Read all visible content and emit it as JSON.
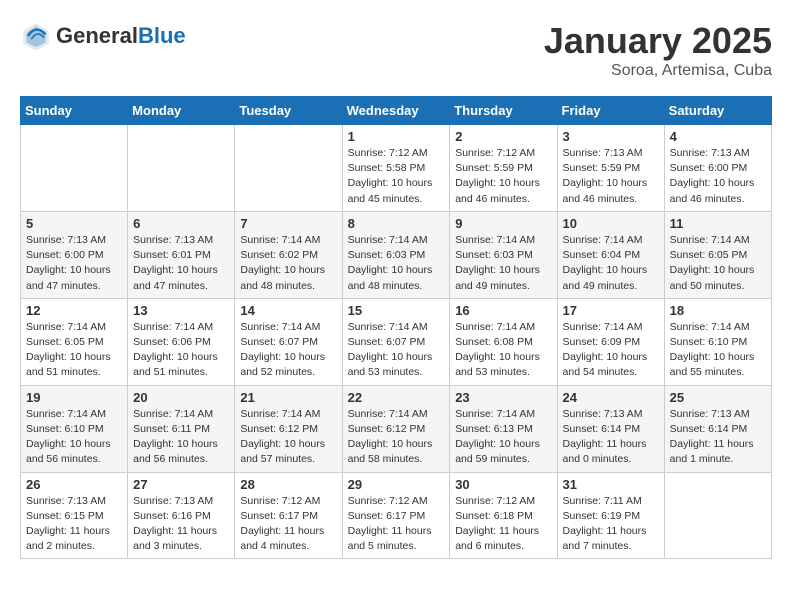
{
  "header": {
    "logo_general": "General",
    "logo_blue": "Blue",
    "month_year": "January 2025",
    "location": "Soroa, Artemisa, Cuba"
  },
  "days_of_week": [
    "Sunday",
    "Monday",
    "Tuesday",
    "Wednesday",
    "Thursday",
    "Friday",
    "Saturday"
  ],
  "weeks": [
    [
      {
        "day": "",
        "info": ""
      },
      {
        "day": "",
        "info": ""
      },
      {
        "day": "",
        "info": ""
      },
      {
        "day": "1",
        "info": "Sunrise: 7:12 AM\nSunset: 5:58 PM\nDaylight: 10 hours\nand 45 minutes."
      },
      {
        "day": "2",
        "info": "Sunrise: 7:12 AM\nSunset: 5:59 PM\nDaylight: 10 hours\nand 46 minutes."
      },
      {
        "day": "3",
        "info": "Sunrise: 7:13 AM\nSunset: 5:59 PM\nDaylight: 10 hours\nand 46 minutes."
      },
      {
        "day": "4",
        "info": "Sunrise: 7:13 AM\nSunset: 6:00 PM\nDaylight: 10 hours\nand 46 minutes."
      }
    ],
    [
      {
        "day": "5",
        "info": "Sunrise: 7:13 AM\nSunset: 6:00 PM\nDaylight: 10 hours\nand 47 minutes."
      },
      {
        "day": "6",
        "info": "Sunrise: 7:13 AM\nSunset: 6:01 PM\nDaylight: 10 hours\nand 47 minutes."
      },
      {
        "day": "7",
        "info": "Sunrise: 7:14 AM\nSunset: 6:02 PM\nDaylight: 10 hours\nand 48 minutes."
      },
      {
        "day": "8",
        "info": "Sunrise: 7:14 AM\nSunset: 6:03 PM\nDaylight: 10 hours\nand 48 minutes."
      },
      {
        "day": "9",
        "info": "Sunrise: 7:14 AM\nSunset: 6:03 PM\nDaylight: 10 hours\nand 49 minutes."
      },
      {
        "day": "10",
        "info": "Sunrise: 7:14 AM\nSunset: 6:04 PM\nDaylight: 10 hours\nand 49 minutes."
      },
      {
        "day": "11",
        "info": "Sunrise: 7:14 AM\nSunset: 6:05 PM\nDaylight: 10 hours\nand 50 minutes."
      }
    ],
    [
      {
        "day": "12",
        "info": "Sunrise: 7:14 AM\nSunset: 6:05 PM\nDaylight: 10 hours\nand 51 minutes."
      },
      {
        "day": "13",
        "info": "Sunrise: 7:14 AM\nSunset: 6:06 PM\nDaylight: 10 hours\nand 51 minutes."
      },
      {
        "day": "14",
        "info": "Sunrise: 7:14 AM\nSunset: 6:07 PM\nDaylight: 10 hours\nand 52 minutes."
      },
      {
        "day": "15",
        "info": "Sunrise: 7:14 AM\nSunset: 6:07 PM\nDaylight: 10 hours\nand 53 minutes."
      },
      {
        "day": "16",
        "info": "Sunrise: 7:14 AM\nSunset: 6:08 PM\nDaylight: 10 hours\nand 53 minutes."
      },
      {
        "day": "17",
        "info": "Sunrise: 7:14 AM\nSunset: 6:09 PM\nDaylight: 10 hours\nand 54 minutes."
      },
      {
        "day": "18",
        "info": "Sunrise: 7:14 AM\nSunset: 6:10 PM\nDaylight: 10 hours\nand 55 minutes."
      }
    ],
    [
      {
        "day": "19",
        "info": "Sunrise: 7:14 AM\nSunset: 6:10 PM\nDaylight: 10 hours\nand 56 minutes."
      },
      {
        "day": "20",
        "info": "Sunrise: 7:14 AM\nSunset: 6:11 PM\nDaylight: 10 hours\nand 56 minutes."
      },
      {
        "day": "21",
        "info": "Sunrise: 7:14 AM\nSunset: 6:12 PM\nDaylight: 10 hours\nand 57 minutes."
      },
      {
        "day": "22",
        "info": "Sunrise: 7:14 AM\nSunset: 6:12 PM\nDaylight: 10 hours\nand 58 minutes."
      },
      {
        "day": "23",
        "info": "Sunrise: 7:14 AM\nSunset: 6:13 PM\nDaylight: 10 hours\nand 59 minutes."
      },
      {
        "day": "24",
        "info": "Sunrise: 7:13 AM\nSunset: 6:14 PM\nDaylight: 11 hours\nand 0 minutes."
      },
      {
        "day": "25",
        "info": "Sunrise: 7:13 AM\nSunset: 6:14 PM\nDaylight: 11 hours\nand 1 minute."
      }
    ],
    [
      {
        "day": "26",
        "info": "Sunrise: 7:13 AM\nSunset: 6:15 PM\nDaylight: 11 hours\nand 2 minutes."
      },
      {
        "day": "27",
        "info": "Sunrise: 7:13 AM\nSunset: 6:16 PM\nDaylight: 11 hours\nand 3 minutes."
      },
      {
        "day": "28",
        "info": "Sunrise: 7:12 AM\nSunset: 6:17 PM\nDaylight: 11 hours\nand 4 minutes."
      },
      {
        "day": "29",
        "info": "Sunrise: 7:12 AM\nSunset: 6:17 PM\nDaylight: 11 hours\nand 5 minutes."
      },
      {
        "day": "30",
        "info": "Sunrise: 7:12 AM\nSunset: 6:18 PM\nDaylight: 11 hours\nand 6 minutes."
      },
      {
        "day": "31",
        "info": "Sunrise: 7:11 AM\nSunset: 6:19 PM\nDaylight: 11 hours\nand 7 minutes."
      },
      {
        "day": "",
        "info": ""
      }
    ]
  ]
}
